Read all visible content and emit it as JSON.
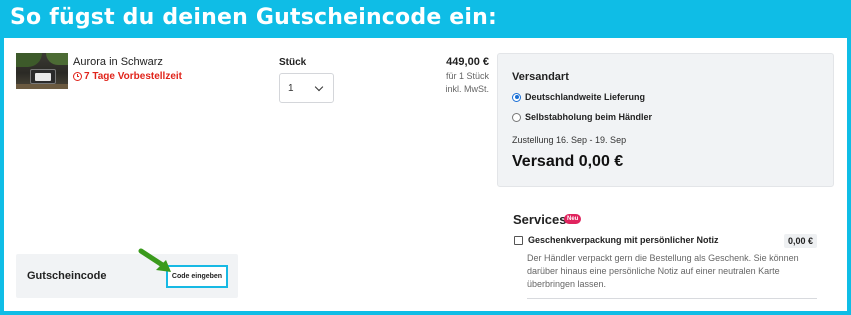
{
  "banner": {
    "title": "So fügst du deinen Gutscheincode ein:"
  },
  "product": {
    "name": "Aurora in Schwarz",
    "preorder": "7 Tage Vorbestellzeit",
    "quantity_label": "Stück",
    "quantity_value": "1",
    "price": "449,00 €",
    "price_unit": "für 1 Stück",
    "price_tax": "inkl. MwSt."
  },
  "shipping": {
    "title": "Versandart",
    "options": [
      {
        "label": "Deutschlandweite Lieferung",
        "selected": true
      },
      {
        "label": "Selbstabholung beim Händler",
        "selected": false
      }
    ],
    "delivery": "Zustellung 16. Sep - 19. Sep",
    "cost": "Versand 0,00 €"
  },
  "services": {
    "title": "Services",
    "badge": "Neu",
    "item_label": "Geschenkverpackung mit persönlicher Notiz",
    "item_price": "0,00 €",
    "item_description": "Der Händler verpackt gern die Bestellung als Geschenk. Sie können darüber hinaus eine persönliche Notiz auf einer neutralen Karte überbringen lassen."
  },
  "voucher": {
    "label": "Gutscheincode",
    "button_label": "Code eingeben"
  },
  "colors": {
    "accent": "#0fbde6",
    "warning": "#e0241b",
    "badge": "#e0245e",
    "arrow": "#3a9a1c"
  },
  "icons": [
    "clock-icon",
    "chevron-down-icon",
    "arrow-icon"
  ]
}
